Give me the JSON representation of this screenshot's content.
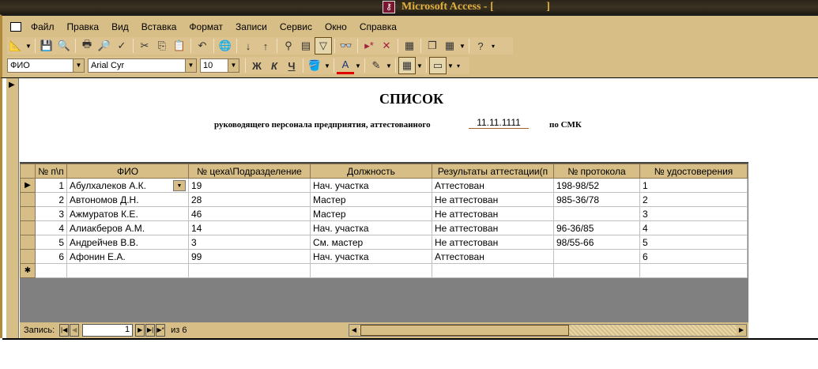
{
  "title": "Microsoft Access - [                   ]",
  "menu": [
    "Файл",
    "Правка",
    "Вид",
    "Вставка",
    "Формат",
    "Записи",
    "Сервис",
    "Окно",
    "Справка"
  ],
  "format_toolbar": {
    "field": "ФИО",
    "font": "Arial Cyr",
    "size": "10",
    "bold": "Ж",
    "italic": "К",
    "underline": "Ч"
  },
  "form": {
    "title": "СПИСОК",
    "subtitle": "руководящего персонала предприятия, аттестованного",
    "date": "11.11.1111",
    "suffix": "по СМК"
  },
  "table": {
    "columns": [
      "№ п\\п",
      "ФИО",
      "№ цеха\\Подразделение",
      "Должность",
      "Результаты аттестации(п",
      "№ протокола",
      "№ удостоверения"
    ],
    "rows": [
      [
        "1",
        "Абулхалеков А.К.",
        "19",
        "Нач. участка",
        "Аттестован",
        "198-98/52",
        "1"
      ],
      [
        "2",
        "Автономов Д.Н.",
        "28",
        "Мастер",
        "Не аттестован",
        "985-36/78",
        "2"
      ],
      [
        "3",
        "Ажмуратов К.Е.",
        "46",
        "Мастер",
        "Не аттестован",
        "",
        "3"
      ],
      [
        "4",
        "Алиакберов А.М.",
        "14",
        "Нач. участка",
        "Не аттестован",
        "96-36/85",
        "4"
      ],
      [
        "5",
        "Андрейчев В.В.",
        "3",
        "См. мастер",
        "Не аттестован",
        "98/55-66",
        "5"
      ],
      [
        "6",
        "Афонин Е.А.",
        "99",
        "Нач. участка",
        "Аттестован",
        "",
        "6"
      ]
    ]
  },
  "nav": {
    "label": "Запись:",
    "current": "1",
    "of": "из 6"
  }
}
